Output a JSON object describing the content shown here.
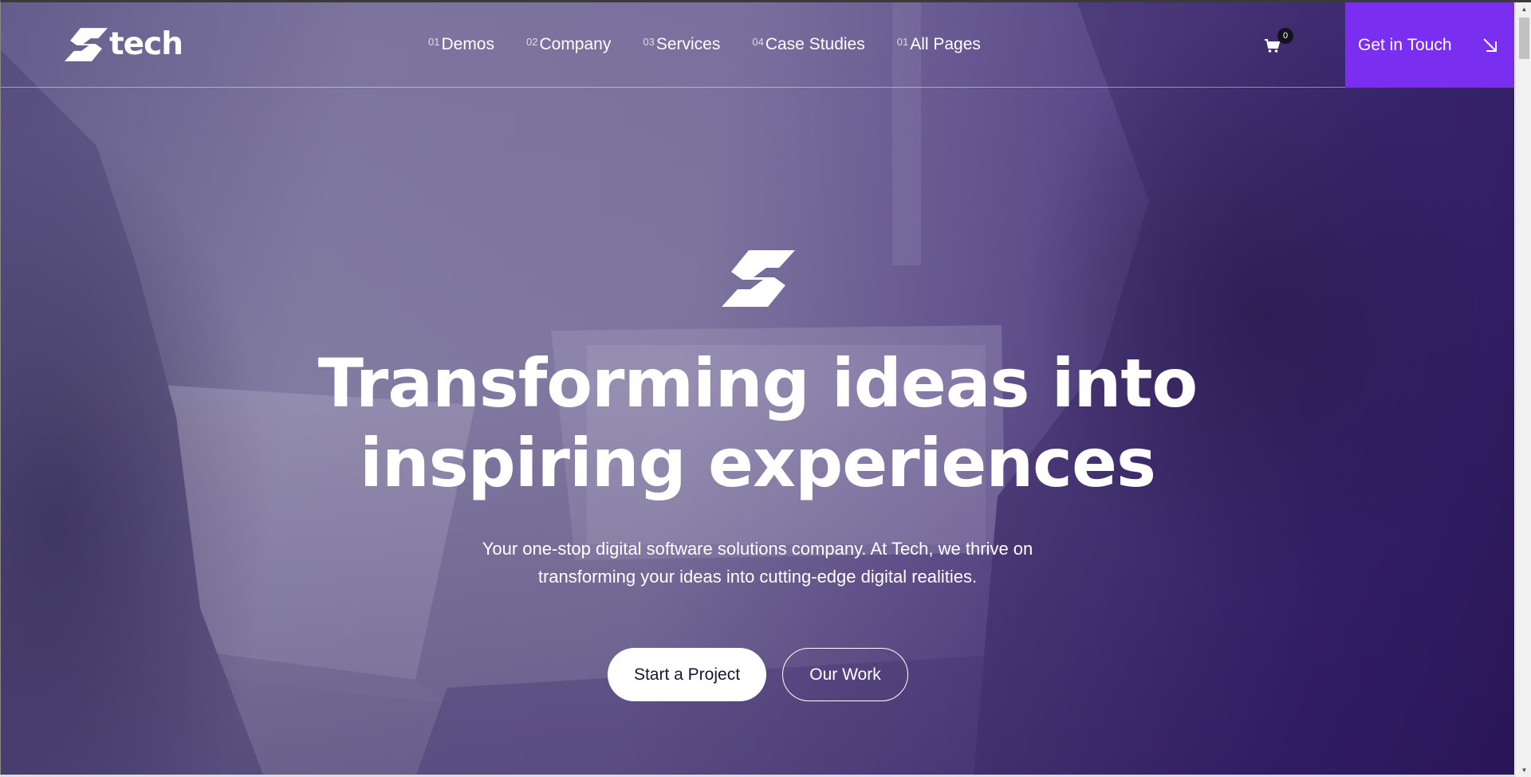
{
  "brand": {
    "name": "tech",
    "logo_icon": "s-logo-icon",
    "accent_color": "#7a2ff0"
  },
  "nav": {
    "items": [
      {
        "num": "01",
        "label": "Demos"
      },
      {
        "num": "02",
        "label": "Company"
      },
      {
        "num": "03",
        "label": "Services"
      },
      {
        "num": "04",
        "label": "Case Studies"
      },
      {
        "num": "01",
        "label": "All Pages"
      }
    ]
  },
  "cart": {
    "icon": "cart-icon",
    "count": "0"
  },
  "cta": {
    "label": "Get in Touch",
    "icon": "arrow-down-right-icon"
  },
  "hero": {
    "title_line1": "Transforming ideas into",
    "title_line2": "inspiring experiences",
    "subtitle_line1": "Your one-stop digital software solutions company. At Tech, we thrive on",
    "subtitle_line2": "transforming your ideas into cutting-edge digital realities.",
    "primary_button": "Start a Project",
    "secondary_button": "Our Work"
  }
}
